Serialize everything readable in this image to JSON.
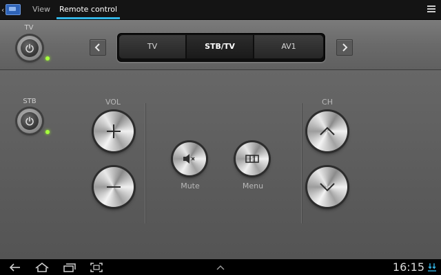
{
  "actionbar": {
    "tabs": [
      {
        "label": "View"
      },
      {
        "label": "Remote control"
      }
    ]
  },
  "devices": {
    "tv_label": "TV",
    "stb_label": "STB"
  },
  "sources": [
    "TV",
    "STB/TV",
    "AV1"
  ],
  "selected_source": "STB/TV",
  "controls": {
    "vol_label": "VOL",
    "ch_label": "CH",
    "mute_label": "Mute",
    "menu_label": "Menu"
  },
  "status": {
    "time": "16:15"
  },
  "colors": {
    "accent": "#33b5e5",
    "led": "#a6ff3d"
  },
  "icons": [
    "back-icon",
    "home-icon",
    "recent-apps-icon",
    "screenshot-icon",
    "menu-up-icon",
    "overflow-menu-icon",
    "power-icon",
    "plus-icon",
    "minus-icon",
    "mute-icon",
    "menu-icon",
    "chevron-up-icon",
    "chevron-down-icon",
    "chevron-left-icon",
    "chevron-right-icon",
    "download-status-icon"
  ]
}
